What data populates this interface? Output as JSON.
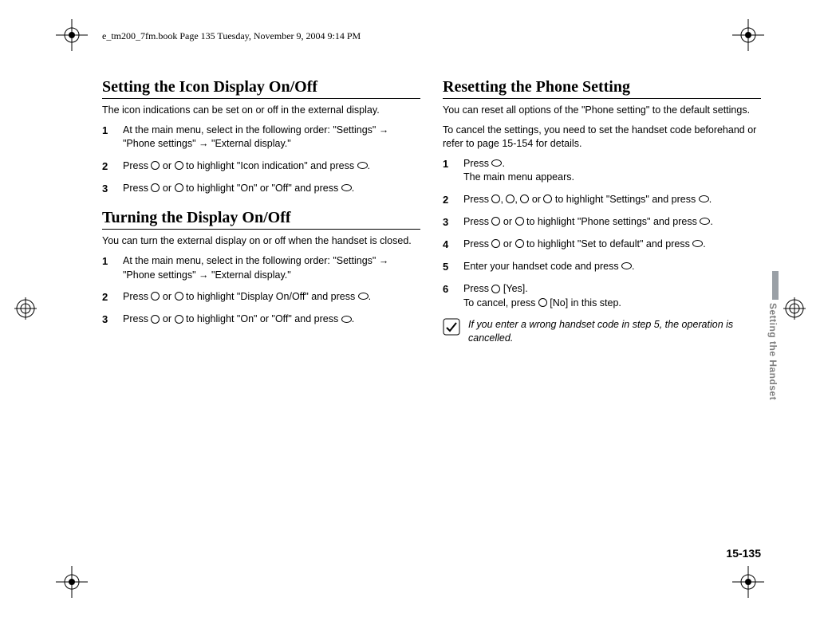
{
  "header": "e_tm200_7fm.book  Page 135  Tuesday, November 9, 2004  9:14 PM",
  "left": {
    "sec1": {
      "title": "Setting the Icon Display On/Off",
      "intro": "The icon indications can be set on or off in the external display.",
      "steps": [
        {
          "n": "1",
          "text": "At the main menu, select in the following order: \"Settings\" → \"Phone settings\" → \"External display.\""
        },
        {
          "n": "2",
          "pre": "Press ",
          "mid": " or ",
          "post": " to highlight \"Icon indication\" and press ",
          "end": "."
        },
        {
          "n": "3",
          "pre": "Press ",
          "mid": " or ",
          "post": " to highlight \"On\" or \"Off\" and press ",
          "end": "."
        }
      ]
    },
    "sec2": {
      "title": "Turning the Display On/Off",
      "intro": "You can turn the external display on or off when the handset is closed.",
      "steps": [
        {
          "n": "1",
          "text": "At the main menu, select in the following order: \"Settings\" → \"Phone settings\" → \"External display.\""
        },
        {
          "n": "2",
          "pre": "Press ",
          "mid": " or ",
          "post": " to highlight \"Display On/Off\" and press ",
          "end": "."
        },
        {
          "n": "3",
          "pre": "Press ",
          "mid": " or ",
          "post": " to highlight \"On\" or \"Off\" and press ",
          "end": "."
        }
      ]
    }
  },
  "right": {
    "sec1": {
      "title": "Resetting the Phone Setting",
      "intro1": "You can reset all options of the \"Phone setting\" to the default settings.",
      "intro2": "To cancel the settings, you need to set the handset code beforehand or refer to page 15-154 for details.",
      "steps": [
        {
          "n": "1",
          "pre": "Press ",
          "end": ".",
          "sub": "The main menu appears."
        },
        {
          "n": "2",
          "pre": "Press ",
          "c": ", ",
          "c2": ", ",
          "c3": " or ",
          "post": " to highlight \"Settings\" and press ",
          "end": "."
        },
        {
          "n": "3",
          "pre": "Press ",
          "mid": " or ",
          "post": " to highlight \"Phone settings\" and press ",
          "end": "."
        },
        {
          "n": "4",
          "pre": "Press ",
          "mid": " or ",
          "post": " to highlight \"Set to default\" and press ",
          "end": "."
        },
        {
          "n": "5",
          "pre": "Enter your handset code and press ",
          "end": "."
        },
        {
          "n": "6",
          "pre": "Press ",
          "post": " [Yes].",
          "sub": "To cancel, press ",
          "sub2": " [No] in this step."
        }
      ],
      "note": "If you enter a wrong handset code in step 5, the operation is cancelled."
    }
  },
  "sideTab": "Setting the Handset",
  "pageNum": "15-135"
}
